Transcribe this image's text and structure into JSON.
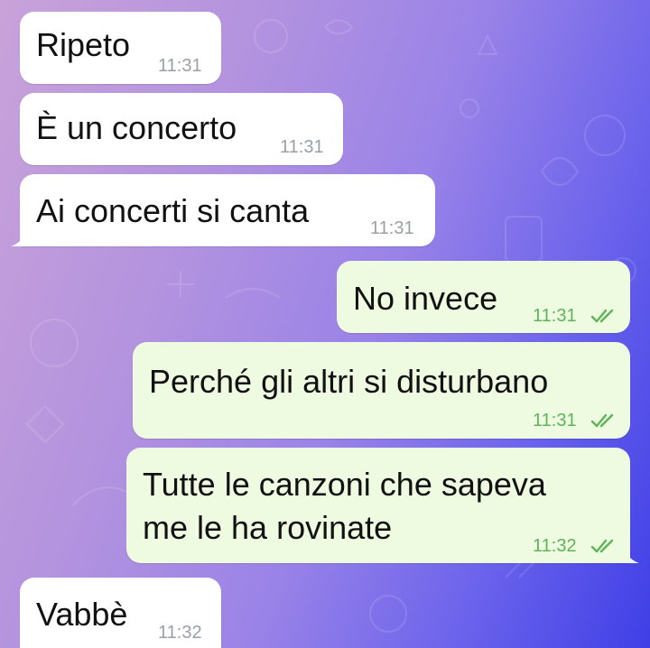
{
  "chat": {
    "messages": [
      {
        "direction": "in",
        "text": "Ripeto",
        "time": "11:31"
      },
      {
        "direction": "in",
        "text": "È un concerto",
        "time": "11:31"
      },
      {
        "direction": "in",
        "text": "Ai concerti si canta",
        "time": "11:31"
      },
      {
        "direction": "out",
        "text": "No invece",
        "time": "11:31",
        "status": "read"
      },
      {
        "direction": "out",
        "text": "Perché gli altri si disturbano",
        "time": "11:31",
        "status": "read"
      },
      {
        "direction": "out",
        "text_line1": "Tutte le canzoni che sapeva",
        "text_line2": "me le ha rovinate",
        "time": "11:32",
        "status": "read"
      },
      {
        "direction": "in",
        "text": "Vabbè",
        "time": "11:32"
      }
    ]
  },
  "colors": {
    "incoming_bubble": "#ffffff",
    "outgoing_bubble": "#eefbe0",
    "outgoing_time": "#5fb35a",
    "incoming_time": "#9aa0a6",
    "read_ticks": "#5fb35a"
  },
  "icons": {
    "read_status": "double-check-icon"
  }
}
